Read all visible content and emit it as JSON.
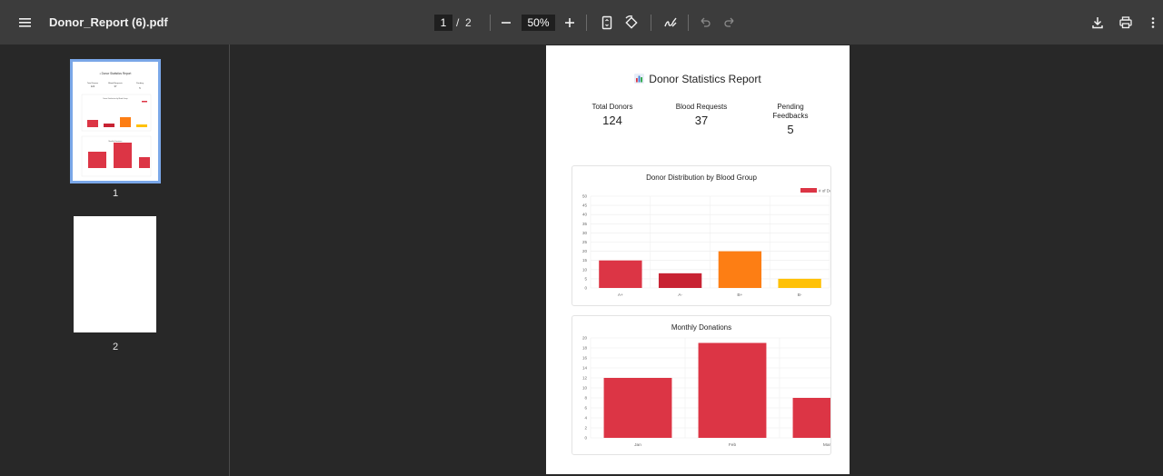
{
  "toolbar": {
    "file_name": "Donor_Report (6).pdf",
    "current_page": "1",
    "page_separator": "/",
    "total_pages": "2",
    "zoom": "50%"
  },
  "sidebar": {
    "thumbnails": [
      {
        "label": "1",
        "selected": true
      },
      {
        "label": "2",
        "selected": false
      }
    ]
  },
  "report": {
    "title": "Donor Statistics Report",
    "stats": [
      {
        "label": "Total Donors",
        "value": "124"
      },
      {
        "label": "Blood Requests",
        "value": "37"
      },
      {
        "label": "Pending Feedbacks",
        "value": "5"
      }
    ]
  },
  "chart_data": [
    {
      "type": "bar",
      "title": "Donor Distribution by Blood Group",
      "categories": [
        "A+",
        "A-",
        "B+",
        "B-"
      ],
      "series": [
        {
          "name": "# of Do",
          "values": [
            15,
            8,
            20,
            5
          ]
        }
      ],
      "colors": [
        "#dc3545",
        "#c82333",
        "#fd7e14",
        "#ffc107"
      ],
      "ylim": [
        0,
        50
      ],
      "yticks": [
        0,
        5,
        10,
        15,
        20,
        25,
        30,
        35,
        40,
        45,
        50
      ],
      "grid": true,
      "legend": "top-right"
    },
    {
      "type": "bar",
      "title": "Monthly Donations",
      "categories": [
        "Jan",
        "Feb",
        "Mar"
      ],
      "values": [
        12,
        19,
        8
      ],
      "colors": [
        "#dc3545"
      ],
      "ylim": [
        0,
        20
      ],
      "yticks": [
        0,
        2,
        4,
        6,
        8,
        10,
        12,
        14,
        16,
        18,
        20
      ],
      "grid": true
    }
  ]
}
